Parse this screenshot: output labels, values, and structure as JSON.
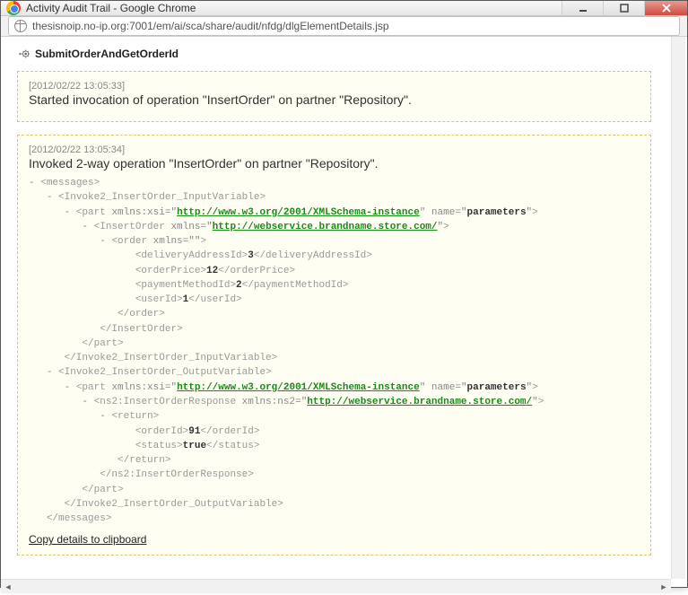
{
  "window": {
    "title": "Activity Audit Trail - Google Chrome",
    "url": "thesisnoip.no-ip.org:7001/em/ai/sca/share/audit/nfdg/dlgElementDetails.jsp"
  },
  "page": {
    "activity_name": "SubmitOrderAndGetOrderId",
    "copy_link": "Copy details to clipboard"
  },
  "panels": [
    {
      "timestamp": "[2012/02/22 13:05:33]",
      "message": "Started invocation of operation \"InsertOrder\" on partner \"Repository\"."
    },
    {
      "timestamp": "[2012/02/22 13:05:34]",
      "message": "Invoked 2-way operation \"InsertOrder\" on partner \"Repository\"."
    }
  ],
  "xml": {
    "xsi_ns": "http://www.w3.org/2001/XMLSchema-instance",
    "part_name": "parameters",
    "ws_ns": "http://webservice.brandname.store.com/",
    "input": {
      "deliveryAddressId": "3",
      "orderPrice": "12",
      "paymentMethodId": "2",
      "userId": "1"
    },
    "output": {
      "orderId": "91",
      "status": "true"
    }
  }
}
